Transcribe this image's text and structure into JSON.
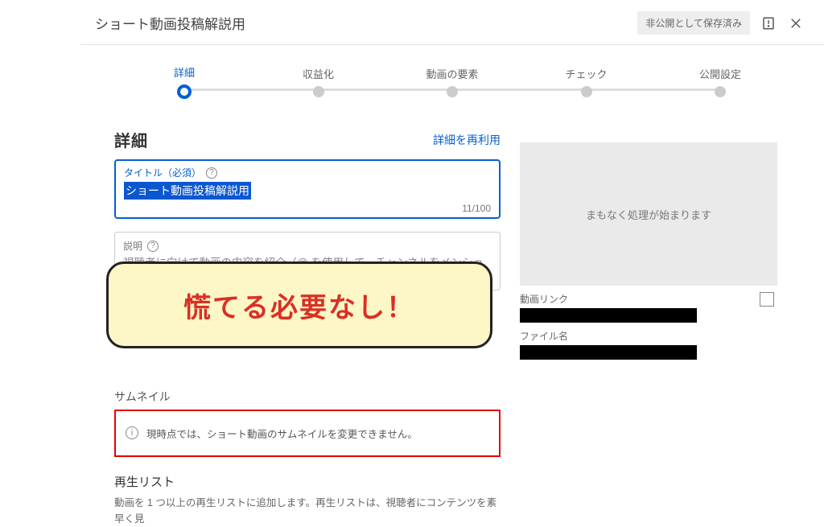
{
  "header": {
    "title": "ショート動画投稿解説用",
    "save_status": "非公開として保存済み"
  },
  "stepper": {
    "step1": "詳細",
    "step2": "収益化",
    "step3": "動画の要素",
    "step4": "チェック",
    "step5": "公開設定"
  },
  "detail": {
    "heading": "詳細",
    "reuse": "詳細を再利用",
    "title_label": "タイトル（必須）",
    "title_value": "ショート動画投稿解説用",
    "char_count": "11/100",
    "desc_label": "説明",
    "desc_placeholder": "視聴者に向けて動画の内容を紹介（@ を使用して、チャンネルをメンションできます）"
  },
  "callout": {
    "text": "慌てる必要なし！"
  },
  "thumbnail": {
    "heading": "サムネイル",
    "notice": "現時点では、ショート動画のサムネイルを変更できません。"
  },
  "playlist": {
    "heading": "再生リスト",
    "desc": "動画を 1 つ以上の再生リストに追加します。再生リストは、視聴者にコンテンツを素早く見"
  },
  "preview": {
    "processing": "まもなく処理が始まります",
    "link_label": "動画リンク",
    "file_label": "ファイル名"
  }
}
